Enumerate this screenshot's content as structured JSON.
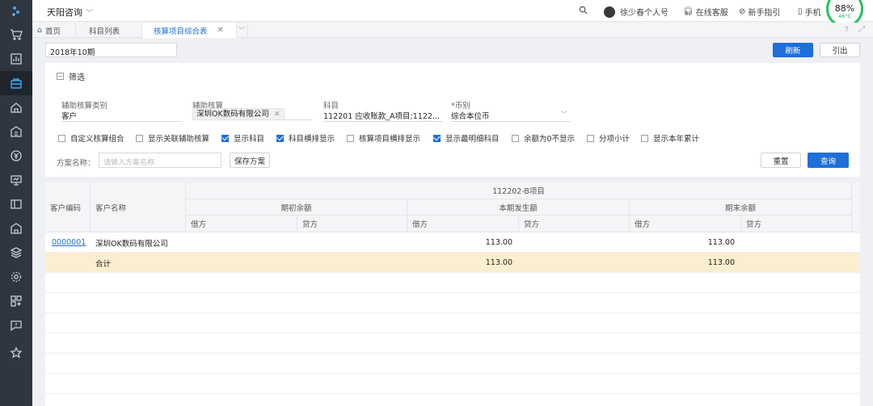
{
  "sidebar": {
    "icons": [
      "logo-icon",
      "cart-icon",
      "chart-icon",
      "bag-icon",
      "home-icon",
      "building-icon",
      "yen-icon",
      "presentation-icon",
      "ticket-icon",
      "bank-icon",
      "layers-icon",
      "gear-icon",
      "apps-icon",
      "message-icon",
      "star-icon"
    ],
    "active_index": 3
  },
  "topbar": {
    "company": "天阳咨询",
    "user": "徐少春个人号",
    "service": "在线客服",
    "guide": "新手指引",
    "mobile": "手机",
    "gauge_percent": "88%",
    "gauge_temp": "46°C"
  },
  "tabs": [
    {
      "label": "首页"
    },
    {
      "label": "科目列表"
    },
    {
      "label": "核算项目综合表"
    }
  ],
  "toolbar": {
    "period": "2018年10期",
    "refresh": "刷新",
    "export": "引出"
  },
  "filter": {
    "title": "筛选",
    "fields": {
      "aux_type_label": "辅助核算类别",
      "aux_type_value": "客户",
      "aux_label": "辅助核算",
      "aux_value": "深圳OK数码有限公司",
      "subject_label": "科目",
      "subject_value": "112201 应收账款_A项目;1122...",
      "currency_label": "*币别",
      "currency_value": "综合本位币"
    },
    "checkboxes": [
      {
        "label": "自定义核算组合",
        "checked": false
      },
      {
        "label": "显示关联辅助核算",
        "checked": false
      },
      {
        "label": "显示科目",
        "checked": true
      },
      {
        "label": "科目横排显示",
        "checked": true
      },
      {
        "label": "核算项目横排显示",
        "checked": false
      },
      {
        "label": "显示最明细科目",
        "checked": true
      },
      {
        "label": "余额为0不显示",
        "checked": false
      },
      {
        "label": "分项小计",
        "checked": false
      },
      {
        "label": "显示本年累计",
        "checked": false
      }
    ],
    "scheme_label": "方案名称：",
    "scheme_placeholder": "请输入方案名称",
    "save_scheme": "保存方案",
    "reset": "重置",
    "query": "查询"
  },
  "table": {
    "col_customer_code": "客户编码",
    "col_customer_name": "客户名称",
    "group_header": "112202-B项目",
    "sub_groups": [
      "期初余额",
      "本期发生额",
      "期末余额"
    ],
    "debit": "借方",
    "credit": "贷方",
    "rows": [
      {
        "code": "0000001",
        "name": "深圳OK数码有限公司",
        "period_debit": "113.00",
        "end_debit": "113.00"
      }
    ],
    "total": {
      "label": "合计",
      "period_debit": "113.00",
      "end_debit": "113.00"
    }
  }
}
